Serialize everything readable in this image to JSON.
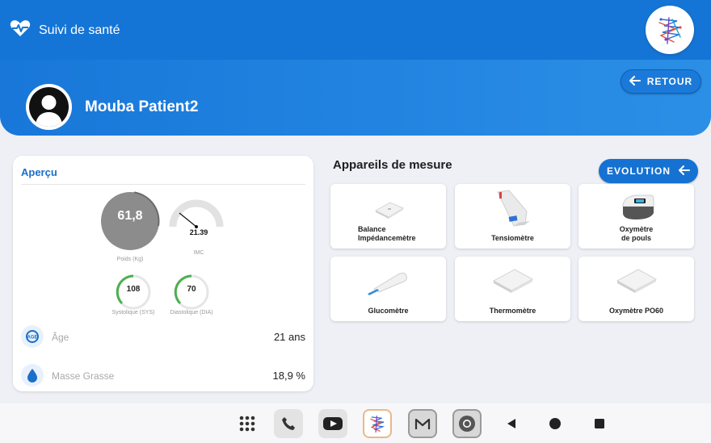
{
  "app": {
    "title": "Suivi de santé",
    "icon": "heart-pulse-icon",
    "logo": "app-logo"
  },
  "patient": {
    "name": "Mouba Patient2",
    "avatar": "user-avatar"
  },
  "header": {
    "retour_label": "RETOUR"
  },
  "apercu": {
    "title": "Aperçu",
    "poids": {
      "value": "61,8",
      "label": "Poids (Kg)"
    },
    "imc": {
      "value": "21.39",
      "label": "IMC"
    },
    "systolique": {
      "value": "108",
      "label": "Systolique (SYS)"
    },
    "diastolique": {
      "value": "70",
      "label": "Diastolique (DIA)"
    },
    "age": {
      "label": "Âge",
      "value": "21 ans",
      "icon": "age-icon"
    },
    "masse": {
      "label": "Masse Grasse",
      "value": "18,9 %",
      "icon": "drop-icon"
    }
  },
  "devices": {
    "title": "Appareils de mesure",
    "evolution_label": "EVOLUTION",
    "items": [
      {
        "label_line1": "Balance",
        "label_line2": "Impédancemètre",
        "icon": "scale-icon"
      },
      {
        "label_line1": "Tensiomètre",
        "label_line2": "",
        "icon": "blood-pressure-monitor-icon"
      },
      {
        "label_line1": "Oxymètre",
        "label_line2": "de pouls",
        "icon": "pulse-oximeter-icon"
      },
      {
        "label_line1": "Glucomètre",
        "label_line2": "",
        "icon": "glucometer-icon"
      },
      {
        "label_line1": "Thermomètre",
        "label_line2": "",
        "icon": "thermometer-icon"
      },
      {
        "label_line1": "Oxymètre PO60",
        "label_line2": "",
        "icon": "oximeter-po60-icon"
      }
    ]
  },
  "colors": {
    "primary": "#1575d6",
    "green": "#4caf50",
    "gauge_gray": "#8c8c8c"
  },
  "navbar": {
    "icons": [
      "apps-grid-icon",
      "phone-icon",
      "youtube-icon",
      "app-logo-icon",
      "mail-icon",
      "chrome-icon",
      "back-icon",
      "home-icon",
      "recents-icon"
    ]
  }
}
